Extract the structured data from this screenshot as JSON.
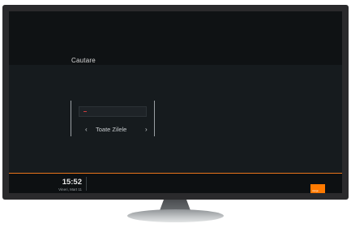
{
  "screen": {
    "title": "Cautare",
    "search": {
      "placeholder": ""
    },
    "filter": {
      "prev_arrow": "‹",
      "next_arrow": "›",
      "day_label": "Toate Zilele"
    }
  },
  "status_bar": {
    "time": "15:52",
    "date": "Vineri, Mart 11",
    "brand": "orange",
    "accent_color": "#e8741c",
    "brand_color": "#ff7a00"
  }
}
